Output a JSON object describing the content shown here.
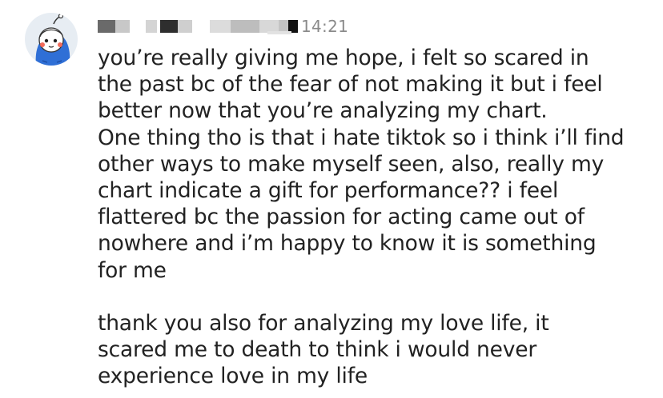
{
  "message": {
    "avatar": "cartoon-character-avatar",
    "sender_name": "",
    "timestamp": "14:21",
    "paragraphs": [
      "you’re really giving me hope, i felt so scared in\nthe past bc of the fear of not making it but i feel\nbetter now that you’re analyzing my chart.\nOne thing tho is that i hate tiktok so i think i’ll find\nother ways to make myself seen, also, really my\nchart indicate a gift for performance?? i feel\nflattered bc the passion for acting came out of\nnowhere and i’m happy to know it is something\nfor me",
      "thank you also for analyzing my love life, it\nscared me to death to think i would never\nexperience love in my life"
    ]
  },
  "colors": {
    "background": "#ffffff",
    "text": "#222222",
    "timestamp": "#8a8a8a",
    "avatar_bg": "#e7edf3",
    "avatar_hood": "#2f6fd6"
  }
}
